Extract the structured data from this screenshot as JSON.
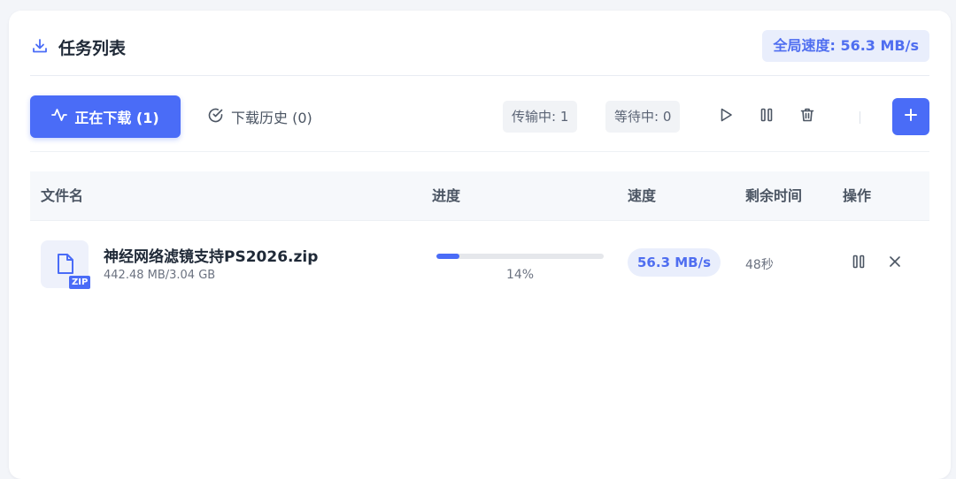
{
  "header": {
    "title": "任务列表",
    "global_speed": "全局速度: 56.3 MB/s",
    "icon": "download-icon"
  },
  "toolbar": {
    "tabs": [
      {
        "label": "正在下载 (1)",
        "icon": "activity-icon",
        "active": true
      },
      {
        "label": "下载历史 (0)",
        "icon": "check-circle-icon",
        "active": false
      }
    ],
    "stats": {
      "transferring": "传输中: 1",
      "waiting": "等待中: 0"
    },
    "actions": [
      "play-icon",
      "pause-icon",
      "trash-icon",
      "plus-icon"
    ]
  },
  "table": {
    "columns": [
      "文件名",
      "进度",
      "速度",
      "剩余时间",
      "操作"
    ],
    "rows": [
      {
        "file_name": "神经网络滤镜支持PS2026.zip",
        "size": "442.48 MB/3.04 GB",
        "type_badge": "ZIP",
        "progress": 0.14,
        "progress_text": "14%",
        "speed": "56.3 MB/s",
        "remaining": "48秒"
      }
    ]
  },
  "colors": {
    "accent": "#4a6cf7",
    "accent_light": "#e9eefc",
    "text_dark": "#1f2937",
    "text_muted": "#6b7280"
  }
}
